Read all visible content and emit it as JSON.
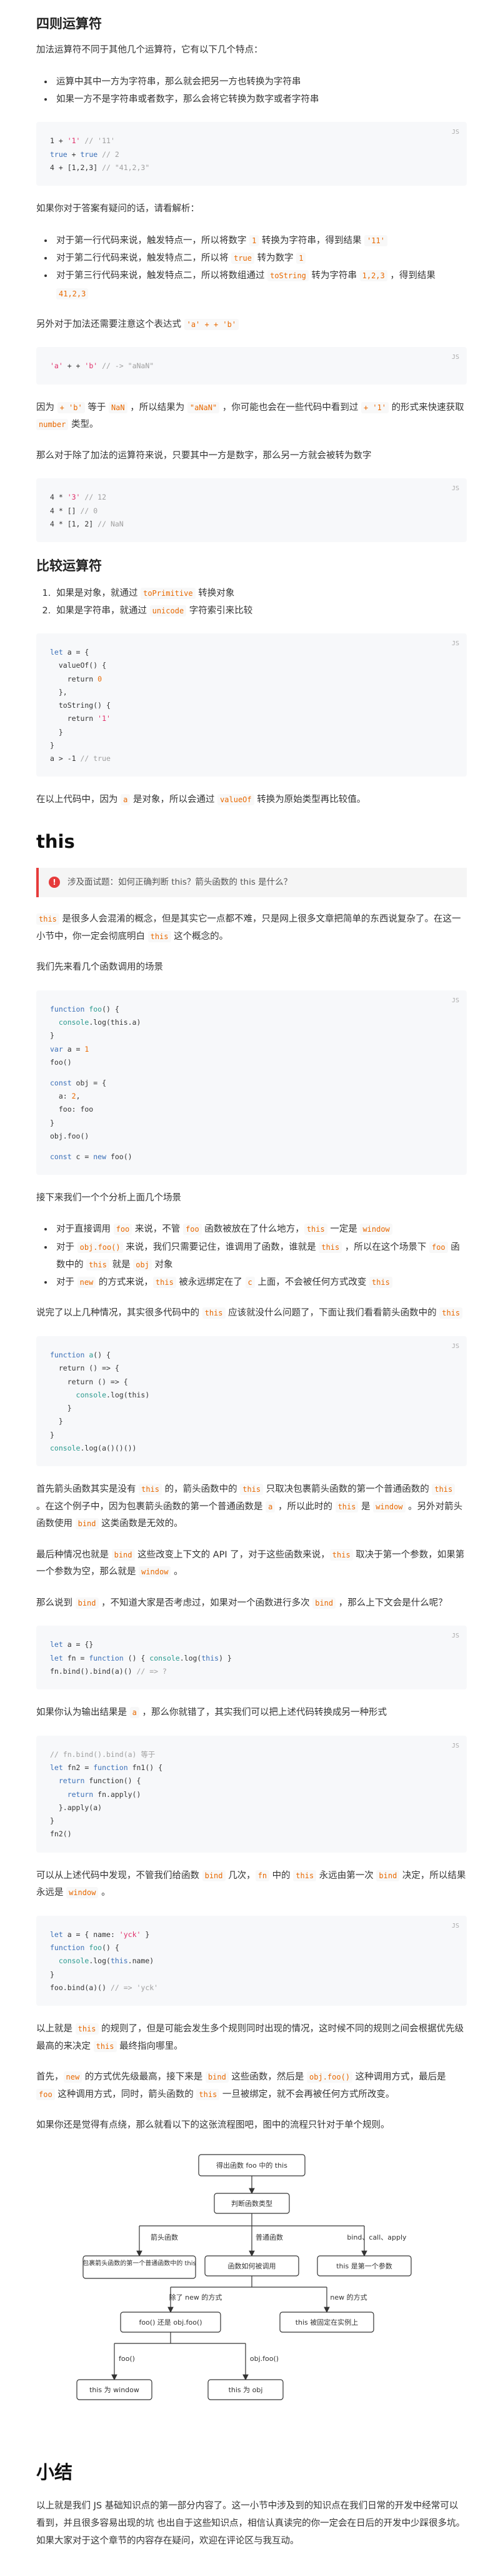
{
  "s1": {
    "title": "四则运算符",
    "intro": "加法运算符不同于其他几个运算符，它有以下几个特点：",
    "bullets": [
      "运算中其中一方为字符串，那么就会把另一方也转换为字符串",
      "如果一方不是字符串或者数字，那么会将它转换为数字或者字符串"
    ],
    "code1": {
      "lang": "JS",
      "lines": [
        [
          [
            "1 + ",
            "p"
          ],
          [
            "'1'",
            "str"
          ],
          [
            " // '11'",
            "com"
          ]
        ],
        [
          [
            "true",
            "kw"
          ],
          [
            " + ",
            "p"
          ],
          [
            "true",
            "kw"
          ],
          [
            " // 2",
            "com"
          ]
        ],
        [
          [
            "4 + [1,2,3] ",
            "p"
          ],
          [
            "// \"41,2,3\"",
            "com"
          ]
        ]
      ]
    },
    "p2": "如果你对于答案有疑问的话，请看解析：",
    "analysis": [
      [
        [
          "t",
          "对于第一行代码来说，触发特点一，所以将数字 "
        ],
        [
          "c",
          "1"
        ],
        [
          "t",
          " 转换为字符串，得到结果 "
        ],
        [
          "c",
          "'11'"
        ]
      ],
      [
        [
          "t",
          "对于第二行代码来说，触发特点二，所以将 "
        ],
        [
          "c",
          "true"
        ],
        [
          "t",
          " 转为数字 "
        ],
        [
          "c",
          "1"
        ]
      ],
      [
        [
          "t",
          "对于第三行代码来说，触发特点二，所以将数组通过 "
        ],
        [
          "c",
          "toString"
        ],
        [
          "t",
          " 转为字符串 "
        ],
        [
          "c",
          "1,2,3"
        ],
        [
          "t",
          " ，得到结果 "
        ],
        [
          "c",
          "41,2,3"
        ]
      ]
    ],
    "p3a": "另外对于加法还需要注意这个表达式 ",
    "p3code": "'a' + + 'b'",
    "code2": {
      "lang": "JS",
      "lines": [
        [
          [
            "'a'",
            "str"
          ],
          [
            " + + ",
            "p"
          ],
          [
            "'b'",
            "str"
          ],
          [
            " // -> \"aNaN\"",
            "com"
          ]
        ]
      ]
    },
    "p4": [
      [
        "t",
        "因为 "
      ],
      [
        "c",
        "+ 'b'"
      ],
      [
        "t",
        " 等于 "
      ],
      [
        "c",
        "NaN"
      ],
      [
        "t",
        " ，所以结果为 "
      ],
      [
        "c",
        "\"aNaN\""
      ],
      [
        "t",
        " ，你可能也会在一些代码中看到过 "
      ],
      [
        "c",
        "+ '1'"
      ],
      [
        "t",
        " 的形式来快速获取 "
      ],
      [
        "c",
        "number"
      ],
      [
        "t",
        " 类型。"
      ]
    ],
    "p5": "那么对于除了加法的运算符来说，只要其中一方是数字，那么另一方就会被转为数字",
    "code3": {
      "lang": "JS",
      "lines": [
        [
          [
            "4 * ",
            "p"
          ],
          [
            "'3'",
            "str"
          ],
          [
            " // 12",
            "com"
          ]
        ],
        [
          [
            "4 * [] ",
            "p"
          ],
          [
            "// 0",
            "com"
          ]
        ],
        [
          [
            "4 * [1, 2] ",
            "p"
          ],
          [
            "// NaN",
            "com"
          ]
        ]
      ]
    }
  },
  "s2": {
    "title": "比较运算符",
    "items": [
      [
        [
          "t",
          "如果是对象，就通过 "
        ],
        [
          "c",
          "toPrimitive"
        ],
        [
          "t",
          " 转换对象"
        ]
      ],
      [
        [
          "t",
          "如果是字符串，就通过 "
        ],
        [
          "c",
          "unicode"
        ],
        [
          "t",
          " 字符索引来比较"
        ]
      ]
    ],
    "code": {
      "lang": "JS",
      "lines": [
        [
          [
            "let",
            "kw"
          ],
          [
            " a = {",
            "p"
          ]
        ],
        [
          [
            "  valueOf() {",
            "p"
          ]
        ],
        [
          [
            "    return ",
            "p"
          ],
          [
            "0",
            "num"
          ]
        ],
        [
          [
            "  },",
            "p"
          ]
        ],
        [
          [
            "  toString() {",
            "p"
          ]
        ],
        [
          [
            "    return ",
            "p"
          ],
          [
            "'1'",
            "str"
          ]
        ],
        [
          [
            "  }",
            "p"
          ]
        ],
        [
          [
            "}",
            "p"
          ]
        ],
        [
          [
            "a > -1 ",
            "p"
          ],
          [
            "// true",
            "com"
          ]
        ]
      ]
    },
    "p": [
      [
        "t",
        "在以上代码中，因为 "
      ],
      [
        "c",
        "a"
      ],
      [
        "t",
        " 是对象，所以会通过 "
      ],
      [
        "c",
        "valueOf"
      ],
      [
        "t",
        " 转换为原始类型再比较值。"
      ]
    ]
  },
  "s3": {
    "title": "this",
    "callout": "涉及面试题：如何正确判断 this？箭头函数的 this 是什么？",
    "callout_icon": "!",
    "p1": [
      [
        "c",
        "this"
      ],
      [
        "t",
        " 是很多人会混淆的概念，但是其实它一点都不难，只是网上很多文章把简单的东西说复杂了。在这一小节中，你一定会彻底明白 "
      ],
      [
        "c",
        "this"
      ],
      [
        "t",
        " 这个概念的。"
      ]
    ],
    "p2": "我们先来看几个函数调用的场景",
    "code1": {
      "lang": "JS",
      "lines": [
        [
          [
            "function",
            "kw"
          ],
          [
            " ",
            "p"
          ],
          [
            "foo",
            "fn"
          ],
          [
            "() {",
            "p"
          ]
        ],
        [
          [
            "  console",
            "fn"
          ],
          [
            ".log(this.a)",
            "p"
          ]
        ],
        [
          [
            "}",
            "p"
          ]
        ],
        [
          [
            "var",
            "kw"
          ],
          [
            " a = ",
            "p"
          ],
          [
            "1",
            "num"
          ]
        ],
        [
          [
            "foo()",
            "p"
          ]
        ],
        [
          [
            "",
            "p"
          ]
        ],
        [
          [
            "const",
            "kw"
          ],
          [
            " obj = {",
            "p"
          ]
        ],
        [
          [
            "  a: ",
            "p"
          ],
          [
            "2",
            "num"
          ],
          [
            ",",
            "p"
          ]
        ],
        [
          [
            "  foo: foo",
            "p"
          ]
        ],
        [
          [
            "}",
            "p"
          ]
        ],
        [
          [
            "obj.foo()",
            "p"
          ]
        ],
        [
          [
            "",
            "p"
          ]
        ],
        [
          [
            "const",
            "kw"
          ],
          [
            " c = ",
            "p"
          ],
          [
            "new",
            "kw"
          ],
          [
            " foo()",
            "p"
          ]
        ]
      ]
    },
    "p3": "接下来我们一个个分析上面几个场景",
    "list": [
      [
        [
          "t",
          "对于直接调用 "
        ],
        [
          "c",
          "foo"
        ],
        [
          "t",
          " 来说，不管 "
        ],
        [
          "c",
          "foo"
        ],
        [
          "t",
          " 函数被放在了什么地方，"
        ],
        [
          "c",
          "this"
        ],
        [
          "t",
          " 一定是 "
        ],
        [
          "c",
          "window"
        ]
      ],
      [
        [
          "t",
          "对于 "
        ],
        [
          "c",
          "obj.foo()"
        ],
        [
          "t",
          " 来说，我们只需要记住，谁调用了函数，谁就是 "
        ],
        [
          "c",
          "this"
        ],
        [
          "t",
          " ，所以在这个场景下 "
        ],
        [
          "c",
          "foo"
        ],
        [
          "t",
          " 函数中的 "
        ],
        [
          "c",
          "this"
        ],
        [
          "t",
          " 就是 "
        ],
        [
          "c",
          "obj"
        ],
        [
          "t",
          " 对象"
        ]
      ],
      [
        [
          "t",
          "对于 "
        ],
        [
          "c",
          "new"
        ],
        [
          "t",
          " 的方式来说，"
        ],
        [
          "c",
          "this"
        ],
        [
          "t",
          " 被永远绑定在了 "
        ],
        [
          "c",
          "c"
        ],
        [
          "t",
          " 上面，不会被任何方式改变 "
        ],
        [
          "c",
          "this"
        ]
      ]
    ],
    "p4": [
      [
        "t",
        "说完了以上几种情况，其实很多代码中的 "
      ],
      [
        "c",
        "this"
      ],
      [
        "t",
        " 应该就没什么问题了，下面让我们看看箭头函数中的 "
      ],
      [
        "c",
        "this"
      ]
    ],
    "code2": {
      "lang": "JS",
      "lines": [
        [
          [
            "function",
            "kw"
          ],
          [
            " ",
            "p"
          ],
          [
            "a",
            "fn"
          ],
          [
            "() {",
            "p"
          ]
        ],
        [
          [
            "  return () => {",
            "p"
          ]
        ],
        [
          [
            "    return () => {",
            "p"
          ]
        ],
        [
          [
            "      console",
            "fn"
          ],
          [
            ".log(this)",
            "p"
          ]
        ],
        [
          [
            "    }",
            "p"
          ]
        ],
        [
          [
            "  }",
            "p"
          ]
        ],
        [
          [
            "}",
            "p"
          ]
        ],
        [
          [
            "console",
            "fn"
          ],
          [
            ".log(a()()())",
            "p"
          ]
        ]
      ]
    },
    "p5": [
      [
        "t",
        "首先箭头函数其实是没有 "
      ],
      [
        "c",
        "this"
      ],
      [
        "t",
        " 的，箭头函数中的 "
      ],
      [
        "c",
        "this"
      ],
      [
        "t",
        " 只取决包裹箭头函数的第一个普通函数的 "
      ],
      [
        "c",
        "this"
      ],
      [
        "t",
        " 。在这个例子中，因为包裹箭头函数的第一个普通函数是 "
      ],
      [
        "c",
        "a"
      ],
      [
        "t",
        " ，所以此时的 "
      ],
      [
        "c",
        "this"
      ],
      [
        "t",
        " 是 "
      ],
      [
        "c",
        "window"
      ],
      [
        "t",
        " 。另外对箭头函数使用 "
      ],
      [
        "c",
        "bind"
      ],
      [
        "t",
        " 这类函数是无效的。"
      ]
    ],
    "p6": [
      [
        "t",
        "最后种情况也就是 "
      ],
      [
        "c",
        "bind"
      ],
      [
        "t",
        " 这些改变上下文的 API 了，对于这些函数来说，"
      ],
      [
        "c",
        "this"
      ],
      [
        "t",
        " 取决于第一个参数，如果第一个参数为空，那么就是 "
      ],
      [
        "c",
        "window"
      ],
      [
        "t",
        " 。"
      ]
    ],
    "p7": [
      [
        "t",
        "那么说到 "
      ],
      [
        "c",
        "bind"
      ],
      [
        "t",
        " ，不知道大家是否考虑过，如果对一个函数进行多次 "
      ],
      [
        "c",
        "bind"
      ],
      [
        "t",
        " ，那么上下文会是什么呢？"
      ]
    ],
    "code3": {
      "lang": "JS",
      "lines": [
        [
          [
            "let",
            "kw"
          ],
          [
            " a = {}",
            "p"
          ]
        ],
        [
          [
            "let",
            "kw"
          ],
          [
            " fn = ",
            "p"
          ],
          [
            "function",
            "kw"
          ],
          [
            " () { ",
            "p"
          ],
          [
            "console",
            "fn"
          ],
          [
            ".log(",
            "p"
          ],
          [
            "this",
            "kw"
          ],
          [
            ") }",
            "p"
          ]
        ],
        [
          [
            "fn.bind().bind(a)() ",
            "p"
          ],
          [
            "// => ?",
            "com"
          ]
        ]
      ]
    },
    "p8": [
      [
        "t",
        "如果你认为输出结果是 "
      ],
      [
        "c",
        "a"
      ],
      [
        "t",
        " ，那么你就错了，其实我们可以把上述代码转换成另一种形式"
      ]
    ],
    "code4": {
      "lang": "JS",
      "lines": [
        [
          [
            "// fn.bind().bind(a) 等于",
            "com"
          ]
        ],
        [
          [
            "let",
            "kw"
          ],
          [
            " fn2 = ",
            "p"
          ],
          [
            "function",
            "kw"
          ],
          [
            " fn1() {",
            "p"
          ]
        ],
        [
          [
            "  return",
            "kw"
          ],
          [
            " function() {",
            "p"
          ]
        ],
        [
          [
            "    return",
            "kw"
          ],
          [
            " fn.apply()",
            "p"
          ]
        ],
        [
          [
            "  }.apply(a)",
            "p"
          ]
        ],
        [
          [
            "}",
            "p"
          ]
        ],
        [
          [
            "fn2()",
            "p"
          ]
        ]
      ]
    },
    "p9": [
      [
        "t",
        "可以从上述代码中发现，不管我们给函数 "
      ],
      [
        "c",
        "bind"
      ],
      [
        "t",
        " 几次，"
      ],
      [
        "c",
        "fn"
      ],
      [
        "t",
        " 中的 "
      ],
      [
        "c",
        "this"
      ],
      [
        "t",
        " 永远由第一次 "
      ],
      [
        "c",
        "bind"
      ],
      [
        "t",
        " 决定，所以结果永远是 "
      ],
      [
        "c",
        "window"
      ],
      [
        "t",
        " 。"
      ]
    ],
    "code5": {
      "lang": "JS",
      "lines": [
        [
          [
            "let",
            "kw"
          ],
          [
            " a = { name: ",
            "p"
          ],
          [
            "'yck'",
            "str"
          ],
          [
            " }",
            "p"
          ]
        ],
        [
          [
            "function",
            "kw"
          ],
          [
            " ",
            "p"
          ],
          [
            "foo",
            "fn"
          ],
          [
            "() {",
            "p"
          ]
        ],
        [
          [
            "  console",
            "fn"
          ],
          [
            ".log(",
            "p"
          ],
          [
            "this",
            "kw"
          ],
          [
            ".name)",
            "p"
          ]
        ],
        [
          [
            "}",
            "p"
          ]
        ],
        [
          [
            "foo.bind(a)() ",
            "p"
          ],
          [
            "// => 'yck'",
            "com"
          ]
        ]
      ]
    },
    "p10": [
      [
        "t",
        "以上就是 "
      ],
      [
        "c",
        "this"
      ],
      [
        "t",
        " 的规则了，但是可能会发生多个规则同时出现的情况，这时候不同的规则之间会根据优先级最高的来决定 "
      ],
      [
        "c",
        "this"
      ],
      [
        "t",
        " 最终指向哪里。"
      ]
    ],
    "p11": [
      [
        "t",
        "首先，"
      ],
      [
        "c",
        "new"
      ],
      [
        "t",
        " 的方式优先级最高，接下来是 "
      ],
      [
        "c",
        "bind"
      ],
      [
        "t",
        " 这些函数，然后是 "
      ],
      [
        "c",
        "obj.foo()"
      ],
      [
        "t",
        " 这种调用方式，最后是 "
      ],
      [
        "c",
        "foo"
      ],
      [
        "t",
        " 这种调用方式，同时，箭头函数的 "
      ],
      [
        "c",
        "this"
      ],
      [
        "t",
        " 一旦被绑定，就不会再被任何方式所改变。"
      ]
    ],
    "p12": "如果你还是觉得有点绕，那么就看以下的这张流程图吧，图中的流程只针对于单个规则。",
    "flow": {
      "root": "得出函数 foo 中的 this",
      "judge": "判断函数类型",
      "branch_arrow": "箭头函数",
      "branch_normal": "普通函数",
      "branch_bind": "bind、call、apply",
      "arrow_result": "包裹箭头函数的第一个普通函数中的 this",
      "normal_q": "函数如何被调用",
      "bind_result": "this 是第一个参数",
      "not_new": "除了 new 的方式",
      "is_new": "new 的方式",
      "call_style": "foo() 还是 obj.foo()",
      "new_result": "this 被固定在实例上",
      "foo_label": "foo()",
      "obj_label": "obj.foo()",
      "window_result": "this 为 window",
      "obj_result": "this 为 obj"
    }
  },
  "s4": {
    "title": "小结",
    "p": "以上就是我们 JS 基础知识点的第一部分内容了。这一小节中涉及到的知识点在我们日常的开发中经常可以看到，并且很多容易出现的坑 也出自于这些知识点，相信认真读完的你一定会在日后的开发中少踩很多坑。如果大家对于这个章节的内容存在疑问，欢迎在评论区与我互动。"
  }
}
